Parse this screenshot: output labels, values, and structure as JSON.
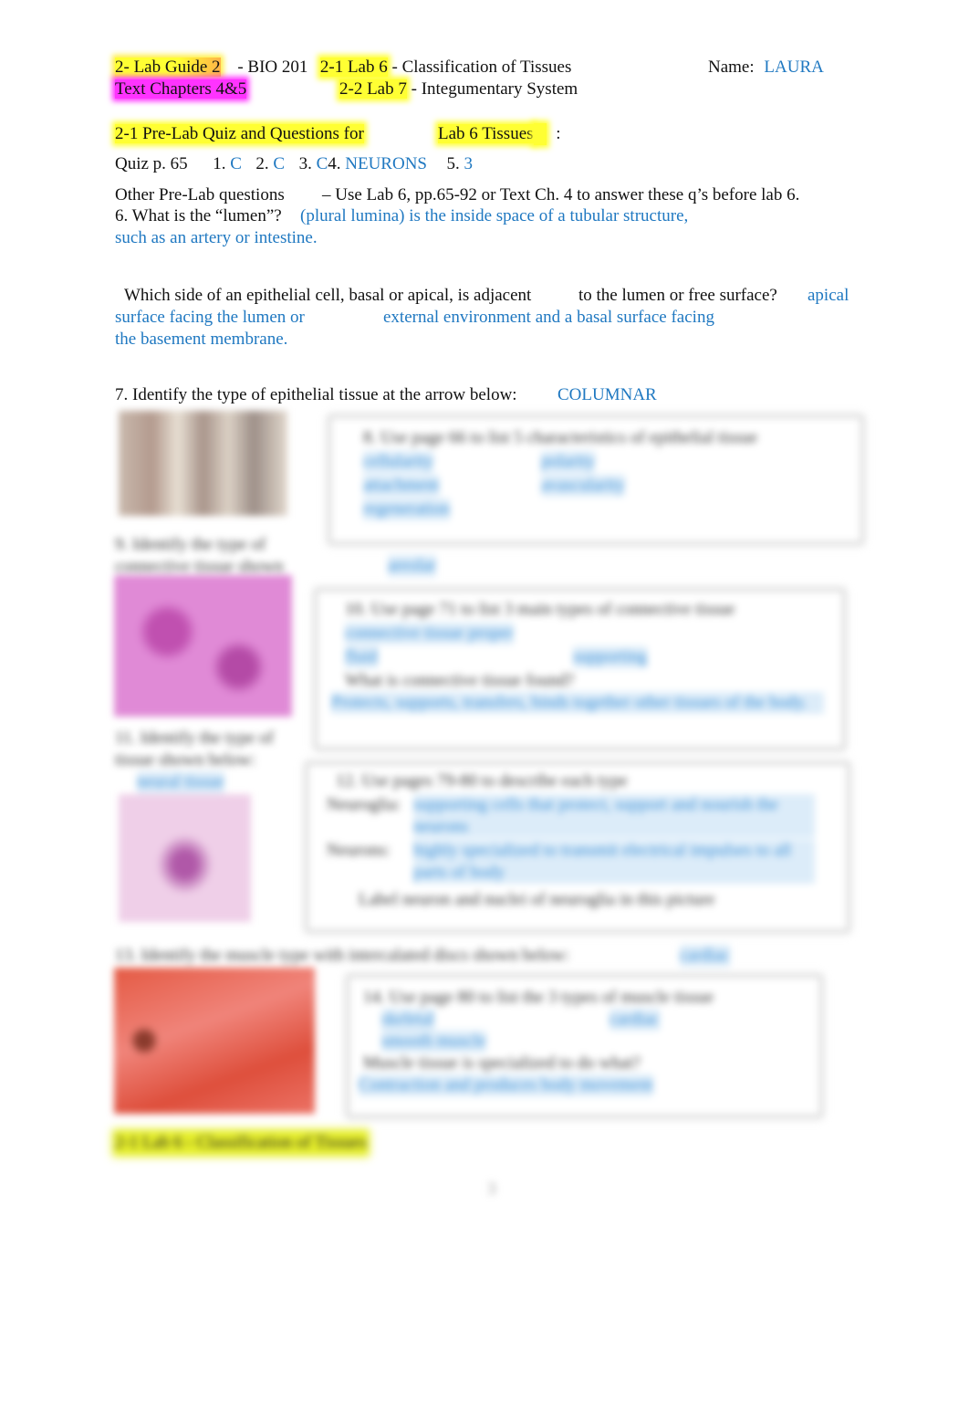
{
  "header": {
    "lab_guide": "2- Lab Guide 2",
    "course": "- BIO 201",
    "lab6_code": "2-1 Lab 6",
    "lab6_title": "- Classification of Tissues",
    "name_label": "Name:",
    "name_value": "LAURA",
    "text_chapters": "Text Chapters 4&5",
    "lab7_code": "2-2 Lab 7",
    "lab7_title": "- Integumentary System"
  },
  "prelab": {
    "heading": "2-1 Pre-Lab Quiz and Questions for",
    "heading_lab": "Lab 6 Tissues",
    "heading_colon": ":",
    "quiz": {
      "label": "Quiz p. 65",
      "items": [
        {
          "num": "1.",
          "answer": "C"
        },
        {
          "num": "2.",
          "answer": "C"
        },
        {
          "num": "3.",
          "answer": "C"
        },
        {
          "num": "4.",
          "answer": "NEURONS"
        },
        {
          "num": "5.",
          "answer": "3"
        }
      ]
    },
    "other_label": "Other Pre-Lab questions",
    "other_instructions": "– Use Lab 6, pp.65-92 or Text Ch. 4 to answer these q’s before lab 6.",
    "q6": {
      "question": "6. What is the “lumen”?",
      "answer_line1": "(plural lumina) is the inside space of a tubular structure,",
      "answer_line2": "such as an artery or intestine."
    },
    "q6b": {
      "question_part1": "Which side of an epithelial cell, basal or apical, is adjacent",
      "question_part2": "to the lumen or free surface?",
      "answer_line1": "apical",
      "answer_line2a": "surface facing the lumen or",
      "answer_line2b": "external environment and a basal surface facing",
      "answer_line3": "the basement membrane."
    },
    "q7": {
      "question": "7. Identify the type of epithelial tissue at the arrow below:",
      "answer": "COLUMNAR"
    }
  },
  "blurred_preview": {
    "box1_title": "8. Use page 66 to list 5 characteristics of epithelial tissue",
    "box1_answers": [
      "cellularity",
      "polarity",
      "attachment",
      "avascularity",
      "regeneration"
    ],
    "q9_label": "9. Identify the type of connective tissue shown below:",
    "q9_answer": "areolar",
    "box2_title": "10. Use page 71 to list 3 main types of connective tissue",
    "box2_answers": [
      "connective tissue proper",
      "fluid",
      "supporting"
    ],
    "box2_question": "What is connective tissue found?",
    "box2_answer": "Protects, supports, transfers, binds together other tissues of the body.",
    "q11_label": "11. Identify the type of tissue shown below:",
    "q11_answer": "neural tissue",
    "box3_title": "12. Use pages 79-80 to describe each type",
    "box3_item1_label": "Neuroglia:",
    "box3_item1_answer": "supporting cells that protect, support and nourish the neurons",
    "box3_item2_label": "Neurons:",
    "box3_item2_answer": "highly specialized to transmit electrical impulses to all parts of body",
    "box3_note": "Label neuron and nuclei of neuroglia in this picture",
    "q13_label": "13. Identify the muscle type with intercalated discs shown below:",
    "q13_answer": "cardiac",
    "box4_title": "14. Use page 80 to list the 3 types of muscle tissue",
    "box4_answers": [
      "skeletal",
      "cardiac",
      "smooth muscle"
    ],
    "box4_question": "Muscle tissue is specialized to do what?",
    "box4_answer": "Contraction and produces body movement",
    "section_label": "2-1 Lab 6 - Classification of Tissues",
    "page_number": "3"
  }
}
